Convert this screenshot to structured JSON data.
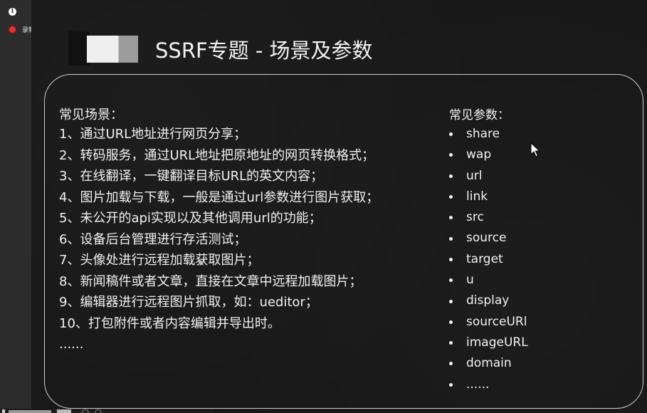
{
  "recorder": {
    "info_icon": "info-icon",
    "recording_label": "录制中",
    "recording_color": "#dd3333"
  },
  "slide": {
    "title": "SSRF专题 - 场景及参数",
    "scenarios": {
      "header": "常见场景：",
      "items": [
        "1、通过URL地址进行网页分享；",
        "2、转码服务，通过URL地址把原地址的网页转换格式；",
        "3、在线翻译，一键翻译目标URL的英文内容；",
        "4、图片加载与下载，一般是通过url参数进行图片获取；",
        "5、未公开的api实现以及其他调用url的功能；",
        "6、设备后台管理进行存活测试；",
        "7、头像处进行远程加载获取图片；",
        "8、新闻稿件或者文章，直接在文章中远程加载图片；",
        "9、编辑器进行远程图片抓取，如：ueditor；",
        "10、打包附件或者内容编辑并导出时。",
        "......"
      ]
    },
    "params": {
      "header": "常见参数：",
      "items": [
        "share",
        "wap",
        "url",
        "link",
        "src",
        "source",
        "target",
        "u",
        "display",
        "sourceURl",
        "imageURL",
        "domain",
        "......"
      ]
    }
  }
}
